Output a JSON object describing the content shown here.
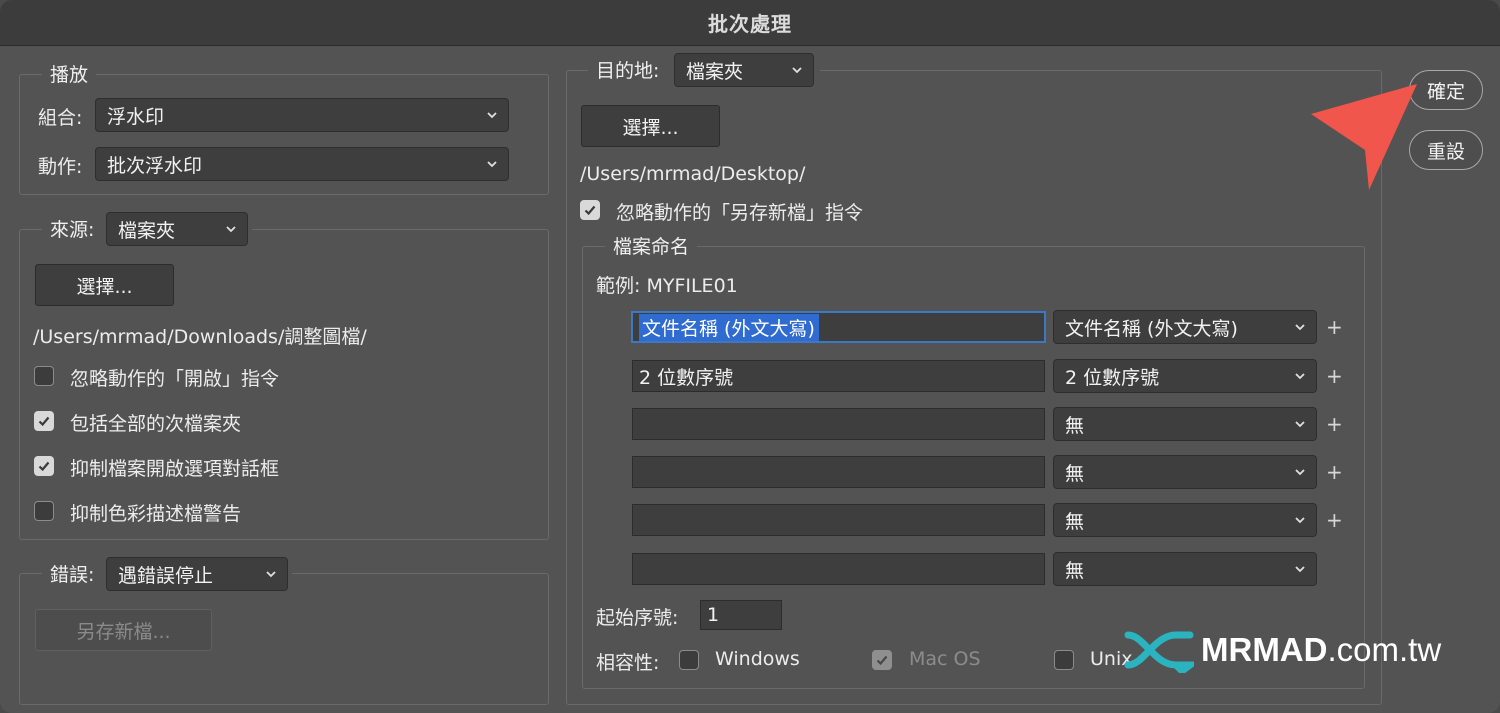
{
  "window": {
    "title": "批次處理"
  },
  "play": {
    "legend": "播放",
    "set_label": "組合:",
    "set_value": "浮水印",
    "action_label": "動作:",
    "action_value": "批次浮水印"
  },
  "source": {
    "label": "來源:",
    "value": "檔案夾",
    "choose_button": "選擇...",
    "path": "/Users/mrmad/Downloads/調整圖檔/",
    "options": [
      {
        "label": "忽略動作的「開啟」指令",
        "checked": false
      },
      {
        "label": "包括全部的次檔案夾",
        "checked": true
      },
      {
        "label": "抑制檔案開啟選項對話框",
        "checked": true
      },
      {
        "label": "抑制色彩描述檔警告",
        "checked": false
      }
    ]
  },
  "errors": {
    "label": "錯誤:",
    "value": "遇錯誤停止",
    "save_as_button": "另存新檔..."
  },
  "destination": {
    "label": "目的地:",
    "value": "檔案夾",
    "choose_button": "選擇...",
    "path": "/Users/mrmad/Desktop/",
    "override_label": "忽略動作的「另存新檔」指令",
    "override_checked": true
  },
  "naming": {
    "legend": "檔案命名",
    "example_label": "範例: MYFILE01",
    "rows": [
      {
        "text": "文件名稱 (外文大寫)",
        "select": "文件名稱 (外文大寫)",
        "plus": "+"
      },
      {
        "text": "2 位數序號",
        "select": "2 位數序號",
        "plus": "+"
      },
      {
        "text": "",
        "select": "無",
        "plus": "+"
      },
      {
        "text": "",
        "select": "無",
        "plus": "+"
      },
      {
        "text": "",
        "select": "無",
        "plus": "+"
      },
      {
        "text": "",
        "select": "無",
        "plus": ""
      }
    ],
    "start_serial_label": "起始序號:",
    "start_serial_value": "1",
    "compat_label": "相容性:",
    "compat": [
      {
        "label": "Windows",
        "checked": false,
        "disabled": false
      },
      {
        "label": "Mac OS",
        "checked": true,
        "disabled": true
      },
      {
        "label": "Unix",
        "checked": false,
        "disabled": false
      }
    ]
  },
  "buttons": {
    "ok": "確定",
    "reset": "重設"
  },
  "watermark": {
    "brand": "MRMAD",
    "suffix": ".com.tw"
  },
  "colors": {
    "arrow": "#f0564c",
    "logo_teal": "#2bb3c0",
    "selection": "#2f6bd0"
  }
}
